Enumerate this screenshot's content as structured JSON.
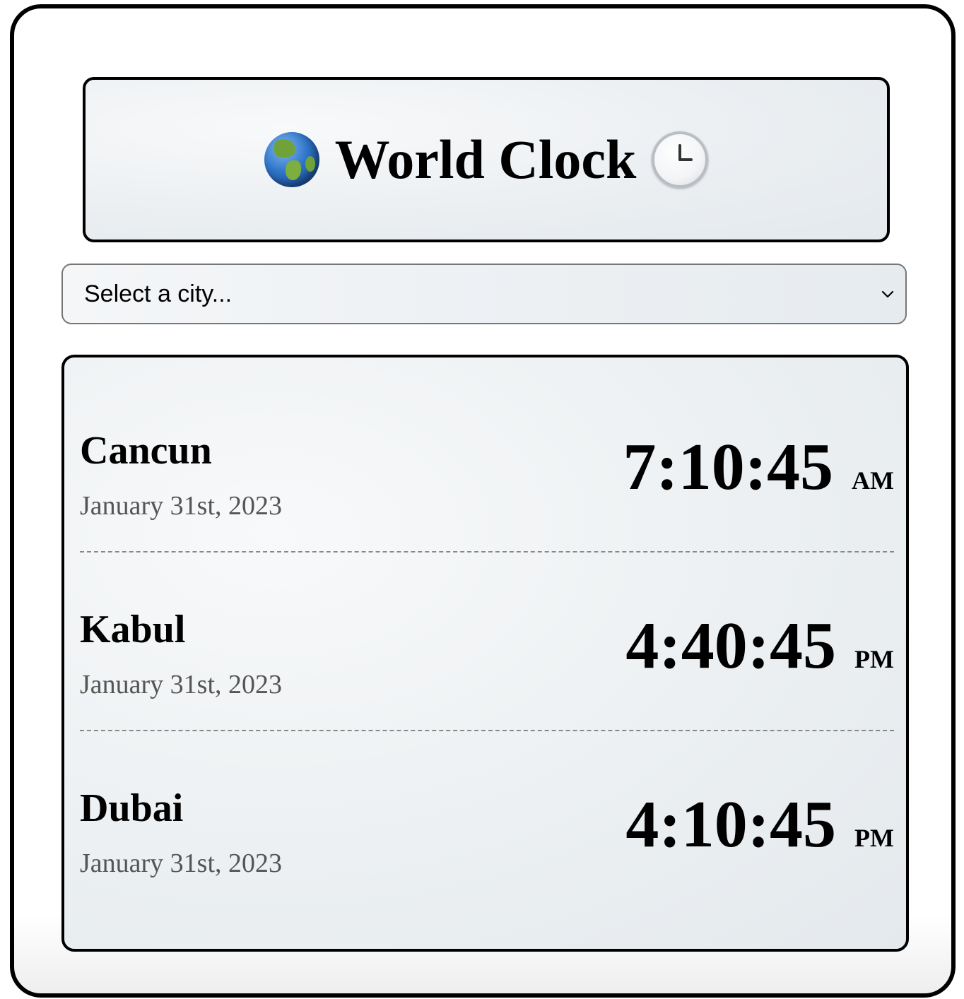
{
  "header": {
    "title": "World Clock",
    "left_icon": "globe-americas-icon",
    "right_icon": "clock-three-icon"
  },
  "city_select": {
    "selected": "Select a city..."
  },
  "cities": [
    {
      "name": "Cancun",
      "date": "January 31st, 2023",
      "time": "7:10:45",
      "ampm": "AM"
    },
    {
      "name": "Kabul",
      "date": "January 31st, 2023",
      "time": "4:40:45",
      "ampm": "PM"
    },
    {
      "name": "Dubai",
      "date": "January 31st, 2023",
      "time": "4:10:45",
      "ampm": "PM"
    }
  ]
}
